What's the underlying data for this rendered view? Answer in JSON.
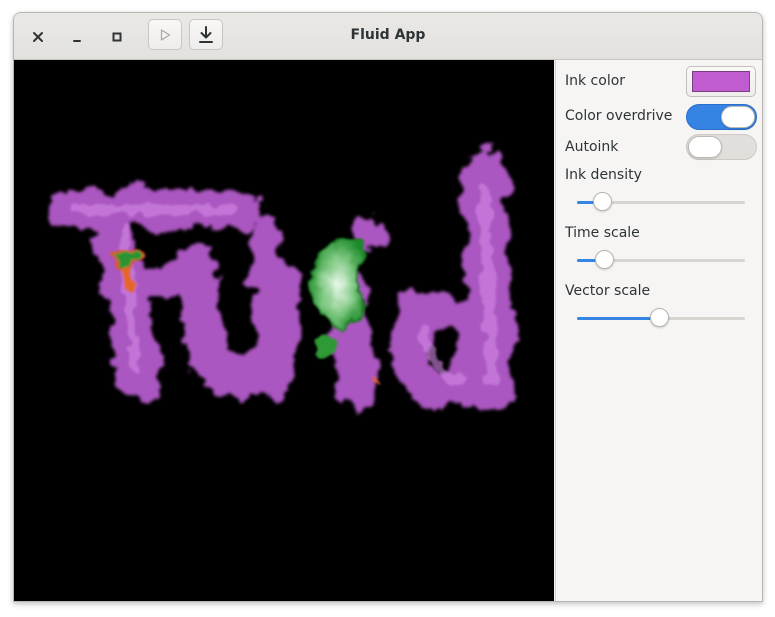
{
  "window": {
    "title": "Fluid App"
  },
  "titlebar": {
    "close_icon": "close-icon",
    "minimize_icon": "minimize-icon",
    "maximize_icon": "maximize-icon",
    "play_icon": "play-icon",
    "download_icon": "download-icon"
  },
  "canvas": {
    "drawn_text": "Fluid",
    "ink_color": "#b95ad0",
    "background": "#000000"
  },
  "controls": {
    "ink_color": {
      "label": "Ink color",
      "value": "#c05ccf"
    },
    "color_overdrive": {
      "label": "Color overdrive",
      "enabled": true
    },
    "autoink": {
      "label": "Autoink",
      "enabled": false
    },
    "ink_density": {
      "label": "Ink density",
      "fraction": 0.15
    },
    "time_scale": {
      "label": "Time scale",
      "fraction": 0.16
    },
    "vector_scale": {
      "label": "Vector scale",
      "fraction": 0.49
    }
  },
  "colors": {
    "accent": "#3584e4"
  }
}
